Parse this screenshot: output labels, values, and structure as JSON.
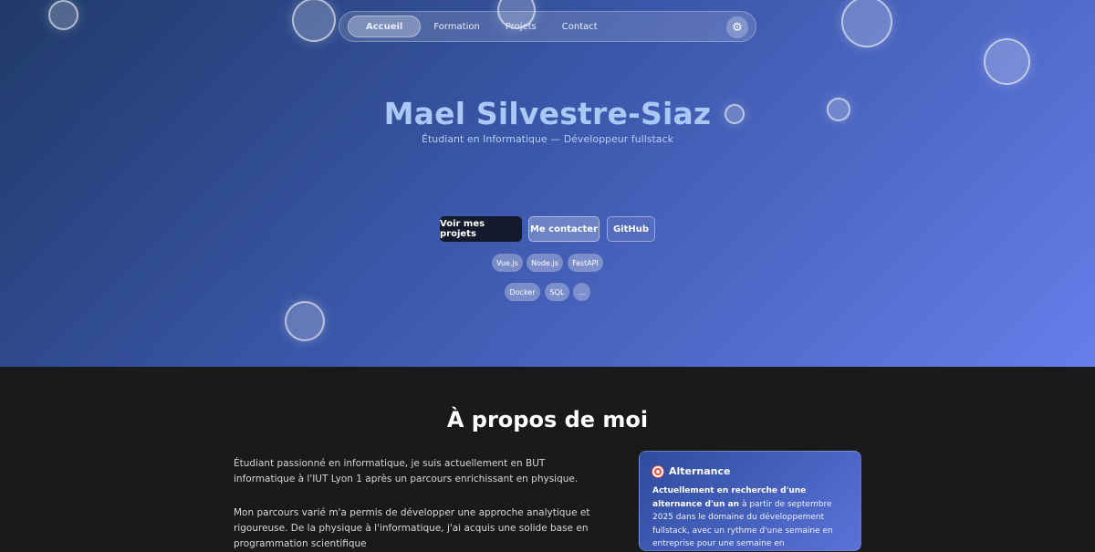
{
  "nav": {
    "items": [
      {
        "label": "Accueil",
        "active": true
      },
      {
        "label": "Formation",
        "active": false
      },
      {
        "label": "Projets",
        "active": false
      },
      {
        "label": "Contact",
        "active": false
      }
    ],
    "settings_icon": "gear-icon"
  },
  "hero": {
    "name": "Mael Silvestre-Siaz",
    "subtitle": "Étudiant en Informatique — Développeur fullstack",
    "buttons": {
      "projects": "Voir mes projets",
      "contact": "Me contacter",
      "github": "GitHub"
    },
    "tags_row1": [
      "Vue.js",
      "Node.js",
      "FastAPI"
    ],
    "tags_row2": [
      "Docker",
      "SQL",
      "..."
    ]
  },
  "about": {
    "title": "À propos de moi",
    "paragraph1": "Étudiant passionné en informatique, je suis actuellement en BUT informatique à l'IUT Lyon 1 après un parcours enrichissant en physique.",
    "paragraph2": "Mon parcours varié m'a permis de développer une approche analytique et rigoureuse. De la physique à l'informatique, j'ai acquis une solide base en programmation scientifique",
    "card": {
      "icon": "target-icon",
      "title": "Alternance",
      "bold_text": "Actuellement en recherche d'une alternance d'un an",
      "text": " à partir de septembre 2025 dans le domaine du développement fullstack, avec un rythme d'une semaine en entreprise pour une semaine en"
    }
  },
  "colors": {
    "hero_gradient_start": "#1f3a68",
    "hero_gradient_end": "#667eea",
    "name_color": "#a9c8f5",
    "primary_button": "#141a2c",
    "about_background": "#1a1a1a"
  }
}
